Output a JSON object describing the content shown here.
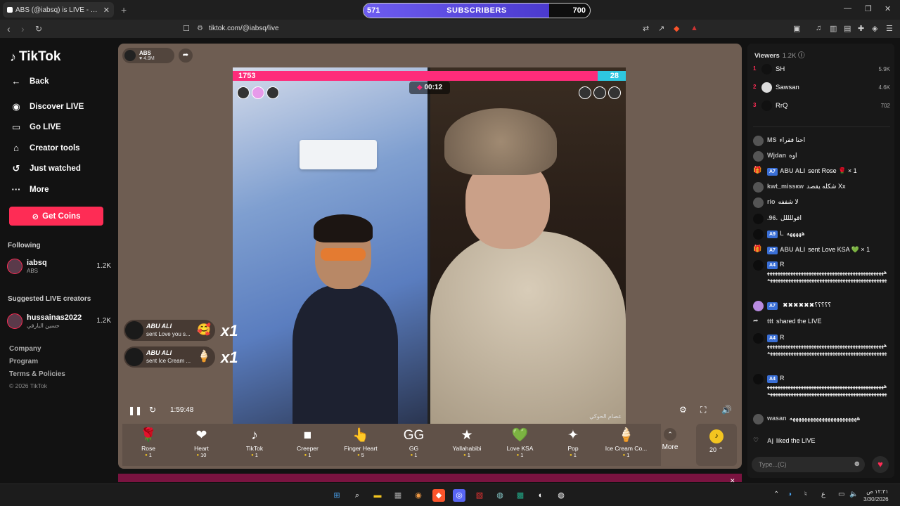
{
  "browser": {
    "tab_title": "ABS (@iabsq) is LIVE - TikTok",
    "url": "tiktok.com/@iabsq/live",
    "subscriber_bar": {
      "left": "571",
      "label": "SUBSCRIBERS",
      "right": "700",
      "progress": 0.82
    }
  },
  "sidebar": {
    "brand": "TikTok",
    "nav": [
      {
        "label": "Back"
      },
      {
        "label": "Discover LIVE"
      },
      {
        "label": "Go LIVE"
      },
      {
        "label": "Creator tools"
      },
      {
        "label": "Just watched"
      },
      {
        "label": "More"
      }
    ],
    "coins_label": "Get Coins",
    "following_header": "Following",
    "following": [
      {
        "name": "iabsq",
        "sub": "ABS",
        "count": "1.2K"
      }
    ],
    "suggested_header": "Suggested LIVE creators",
    "suggested": [
      {
        "name": "hussainas2022",
        "sub": "حسين البارقي",
        "count": "1.2K"
      }
    ],
    "footer": [
      "Company",
      "Program",
      "Terms & Policies"
    ],
    "copyright": "© 2026 TikTok"
  },
  "live": {
    "host_name": "ABS",
    "host_likes": "4.9M",
    "battle_left": "1753",
    "battle_right": "28",
    "battle_timer": "00:12",
    "watermark": "عصام الحوكي",
    "elapsed": "1:59:48",
    "gift_notifications": [
      {
        "user": "ABU ALI",
        "text": "sent Love you s...",
        "icon": "🥰",
        "mult": "x1"
      },
      {
        "user": "ABU ALI",
        "text": "sent Ice Cream ...",
        "icon": "🍦",
        "mult": "x1"
      }
    ],
    "gifts": [
      {
        "name": "Rose",
        "price": "1",
        "icon": "🌹"
      },
      {
        "name": "Heart",
        "price": "10",
        "icon": "❤"
      },
      {
        "name": "TikTok",
        "price": "1",
        "icon": "♪"
      },
      {
        "name": "Creeper",
        "price": "1",
        "icon": "■"
      },
      {
        "name": "Finger Heart",
        "price": "5",
        "icon": "👆"
      },
      {
        "name": "GG",
        "price": "1",
        "icon": "GG"
      },
      {
        "name": "Yallahabibi",
        "price": "1",
        "icon": "★"
      },
      {
        "name": "Love KSA",
        "price": "1",
        "icon": "💚"
      },
      {
        "name": "Pop",
        "price": "1",
        "icon": "✦"
      },
      {
        "name": "Ice Cream Co...",
        "price": "1",
        "icon": "🍦"
      }
    ],
    "more_label": "More",
    "coin_balance": "20"
  },
  "chat": {
    "viewers_label": "Viewers",
    "viewers_count": "1.2K",
    "top_viewers": [
      {
        "rank": "1",
        "name": "SH",
        "score": "5.9K"
      },
      {
        "rank": "2",
        "name": "Sawsan",
        "score": "4.6K"
      },
      {
        "rank": "3",
        "name": "RrQ",
        "score": "702"
      }
    ],
    "messages": [
      {
        "user": "MS",
        "text": "احنا فقراء"
      },
      {
        "user": "Wjdan",
        "text": "اوه"
      },
      {
        "level": "A7",
        "user": "ABU ALI",
        "text": "sent Rose 🌹 × 1"
      },
      {
        "user": "kwt_missкw",
        "text": "شكله يقصد Xx"
      },
      {
        "user": "rio",
        "text": "لا شففه"
      },
      {
        "user": ".96.",
        "text": "اقوللللل"
      },
      {
        "level": "A9",
        "user": "L",
        "text": "هههههه"
      },
      {
        "level": "A7",
        "user": "ABU ALI",
        "text": "sent Love KSA 💚 × 1"
      },
      {
        "level": "A4",
        "user": "R",
        "text": "هههههههههههههههههههههههههههههههههههههههههههههههههههههههههههههههههههههههههههههههههههههههههههه"
      },
      {
        "level": "A7",
        "user": "",
        "text": "✖✖✖✖✖✖؟؟؟؟؟"
      },
      {
        "user": "ttt",
        "text": "shared the LIVE"
      },
      {
        "level": "A4",
        "user": "R",
        "text": "هههههههههههههههههههههههههههههههههههههههههههههههههههههههههههههههههههههههههههههههههههههههههههه"
      },
      {
        "level": "A4",
        "user": "R",
        "text": "هههههههههههههههههههههههههههههههههههههههههههههههههههههههههههههههههههههههههههههههههههههههههههه"
      },
      {
        "user": "wasan",
        "text": "هههههههههههههههههههههههه"
      },
      {
        "user": "Aj",
        "text": "liked the LIVE"
      }
    ],
    "input_placeholder": "Type...(C)"
  },
  "taskbar": {
    "time": "١٢:٣١ ص",
    "date": "3/30/2026"
  }
}
